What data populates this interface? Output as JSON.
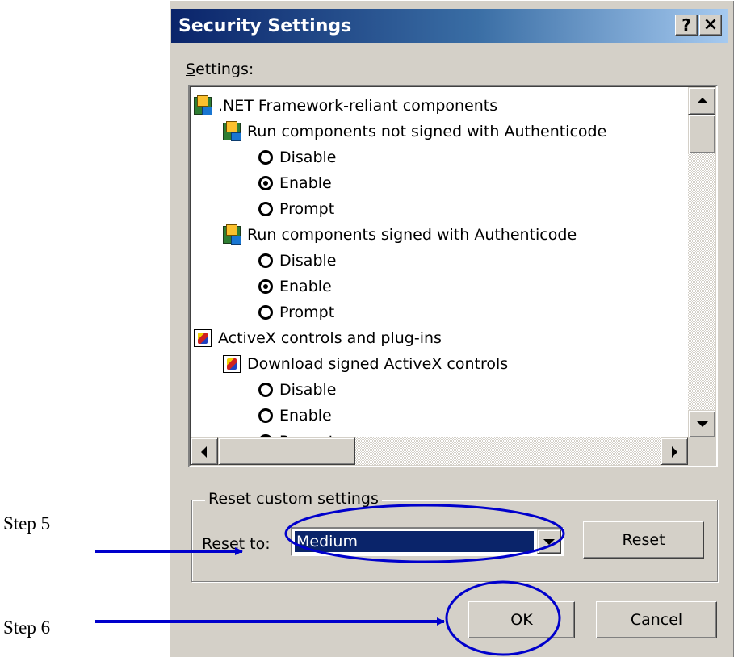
{
  "dialog": {
    "title": "Security Settings",
    "help_button": "?",
    "close_button": "×",
    "settings_label": "Settings:",
    "settings_label_accel": "S",
    "settings_label_rest": "ettings:"
  },
  "tree": [
    {
      "kind": "category",
      "icon": "net-framework-icon",
      "label": ".NET Framework-reliant components"
    },
    {
      "kind": "setting",
      "icon": "net-framework-icon",
      "label": "Run components not signed with Authenticode"
    },
    {
      "kind": "option",
      "label": "Disable",
      "checked": false
    },
    {
      "kind": "option",
      "label": "Enable",
      "checked": true
    },
    {
      "kind": "option",
      "label": "Prompt",
      "checked": false
    },
    {
      "kind": "setting",
      "icon": "net-framework-icon",
      "label": "Run components signed with Authenticode"
    },
    {
      "kind": "option",
      "label": "Disable",
      "checked": false
    },
    {
      "kind": "option",
      "label": "Enable",
      "checked": true
    },
    {
      "kind": "option",
      "label": "Prompt",
      "checked": false
    },
    {
      "kind": "category",
      "icon": "activex-icon",
      "label": "ActiveX controls and plug-ins"
    },
    {
      "kind": "setting",
      "icon": "activex-icon",
      "label": "Download signed ActiveX controls"
    },
    {
      "kind": "option",
      "label": "Disable",
      "checked": false
    },
    {
      "kind": "option",
      "label": "Enable",
      "checked": false
    },
    {
      "kind": "option",
      "label": "Prompt",
      "checked": true
    }
  ],
  "reset_group": {
    "legend": "Reset custom settings",
    "reset_to_label_accel": "R",
    "reset_to_label_rest": "eset to:",
    "selected_level": "Medium",
    "reset_button_pre": "R",
    "reset_button_accel": "e",
    "reset_button_post": "set"
  },
  "buttons": {
    "ok": "OK",
    "cancel": "Cancel"
  },
  "annotations": {
    "step5": "Step 5",
    "step6": "Step 6",
    "color": "#0000cc"
  }
}
